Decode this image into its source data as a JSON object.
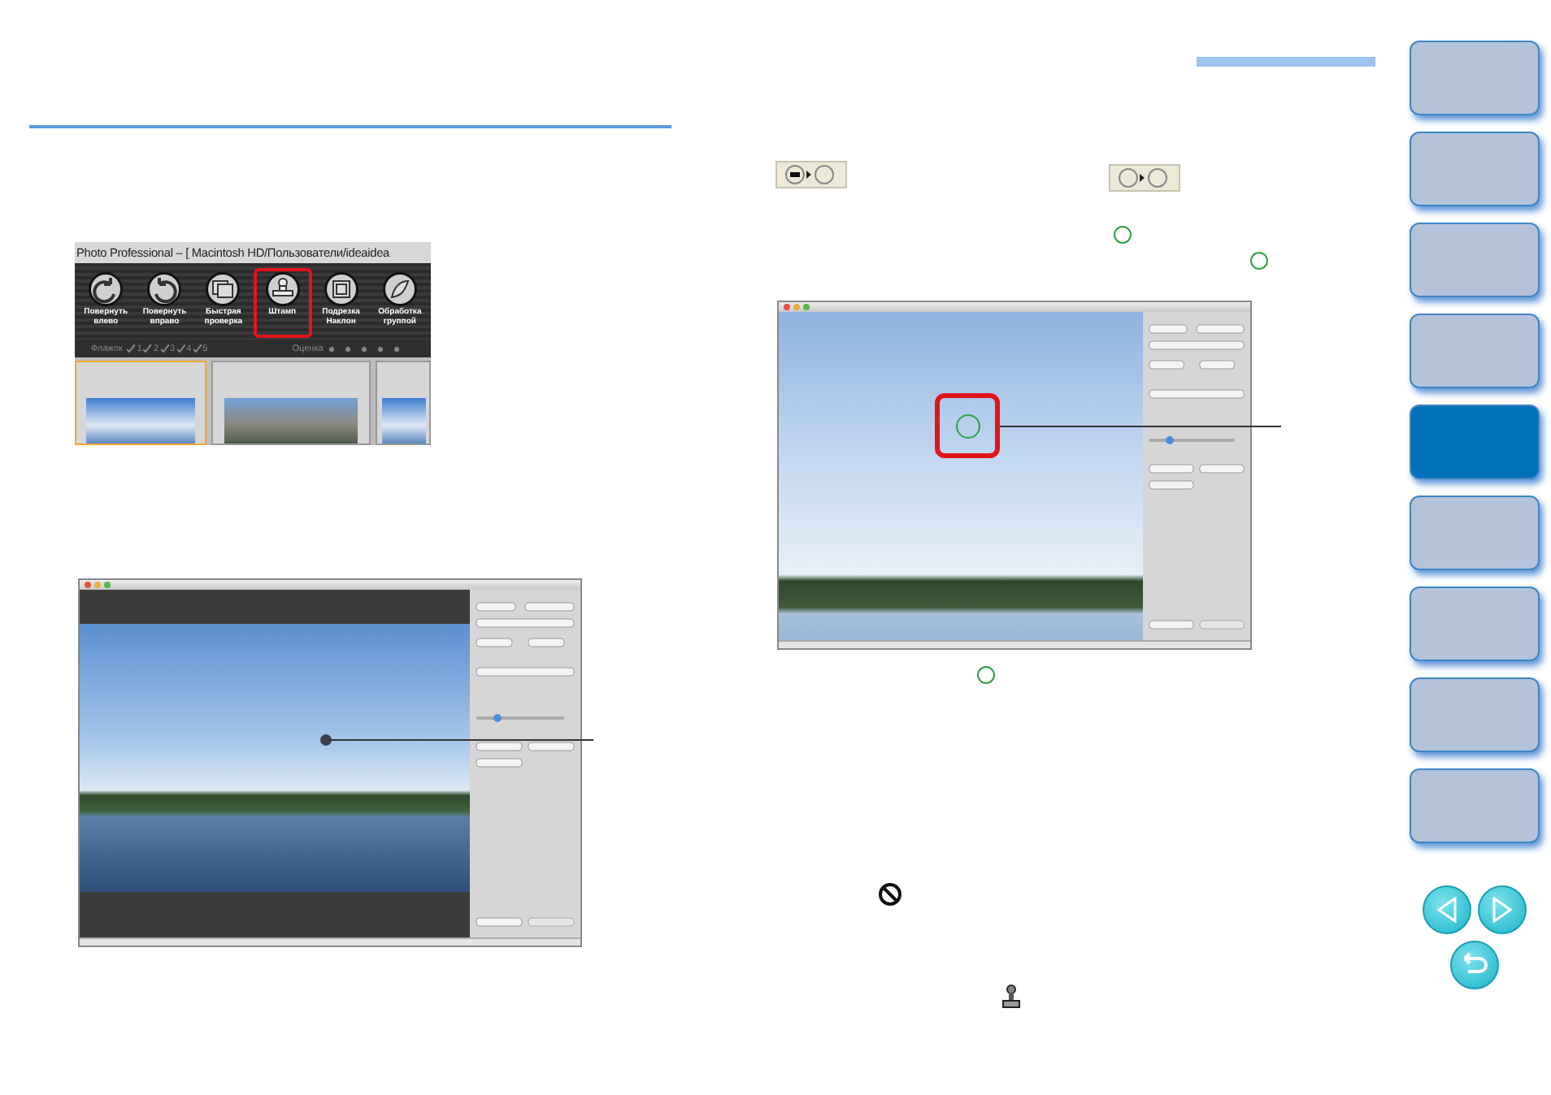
{
  "toolbar_screenshot": {
    "title": "Photo Professional – [ Macintosh HD/Пользователи/ideaidea",
    "buttons": [
      {
        "kind": "rotate_left",
        "label": "Повернуть влево",
        "selected": false
      },
      {
        "kind": "rotate_right",
        "label": "Повернуть вправо",
        "selected": false
      },
      {
        "kind": "quick_check",
        "label": "Быстрая проверка",
        "selected": false
      },
      {
        "kind": "stamp",
        "label": "Штамп",
        "selected": true
      },
      {
        "kind": "crop",
        "label": "Подрезка Наклон",
        "selected": false
      },
      {
        "kind": "batch",
        "label": "Обработка группой",
        "selected": false
      }
    ],
    "flag_label": "Флажок",
    "flag_marks": [
      "1",
      "2",
      "3",
      "4",
      "5"
    ],
    "rating_label": "Оценка",
    "thumbnails": [
      {
        "kind": "sky",
        "selected": true
      },
      {
        "kind": "mountain",
        "selected": false
      },
      {
        "kind": "sky",
        "selected": false
      }
    ]
  },
  "sidebar": {
    "tabs": [
      {
        "selected": false
      },
      {
        "selected": false
      },
      {
        "selected": false
      },
      {
        "selected": false
      },
      {
        "selected": true
      },
      {
        "selected": false
      },
      {
        "selected": false
      },
      {
        "selected": false
      },
      {
        "selected": false
      }
    ]
  }
}
